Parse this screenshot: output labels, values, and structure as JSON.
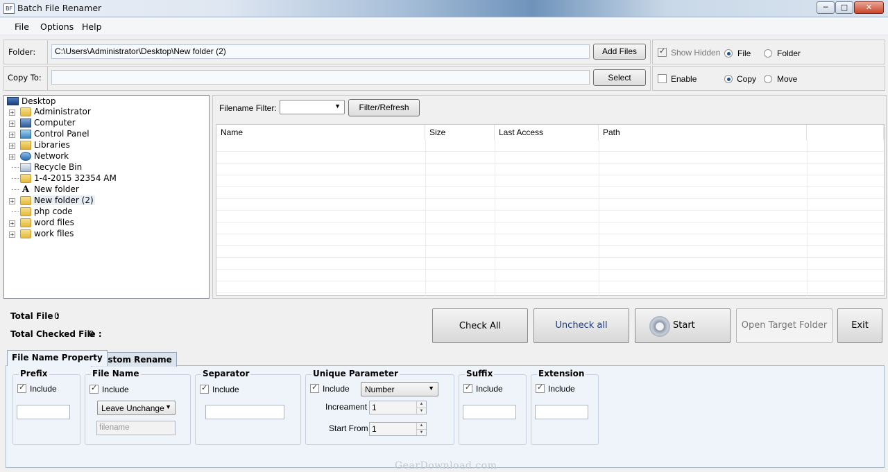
{
  "window": {
    "title": "Batch File Renamer",
    "min": "─",
    "max": "□",
    "close": "✕",
    "icon_text": "BF"
  },
  "menu": [
    "File",
    "Options",
    "Help"
  ],
  "folder": {
    "label": "Folder:",
    "value": "C:\\Users\\Administrator\\Desktop\\New folder (2)",
    "add_files": "Add Files"
  },
  "copy_to": {
    "label": "Copy To:",
    "value": "",
    "select": "Select"
  },
  "options_top": {
    "show_hidden": "Show Hidden",
    "show_hidden_checked": true,
    "file": "File",
    "folder": "Folder",
    "selected": "file"
  },
  "options_bottom": {
    "enable": "Enable",
    "enable_checked": false,
    "copy": "Copy",
    "move": "Move",
    "selected": "copy"
  },
  "tree": {
    "root": "Desktop",
    "items": [
      {
        "label": "Administrator",
        "expandable": true,
        "icon": "user-folder-icon"
      },
      {
        "label": "Computer",
        "expandable": true,
        "icon": "computer-icon"
      },
      {
        "label": "Control Panel",
        "expandable": true,
        "icon": "control-panel-icon"
      },
      {
        "label": "Libraries",
        "expandable": true,
        "icon": "libraries-icon"
      },
      {
        "label": "Network",
        "expandable": true,
        "icon": "network-icon"
      },
      {
        "label": "Recycle Bin",
        "expandable": false,
        "icon": "recycle-bin-icon"
      },
      {
        "label": "1-4-2015 32354 AM",
        "expandable": false,
        "icon": "folder-icon"
      },
      {
        "label": "New folder",
        "expandable": false,
        "icon": "font-icon"
      },
      {
        "label": "New folder (2)",
        "expandable": true,
        "icon": "folder-icon",
        "selected": true
      },
      {
        "label": "php code",
        "expandable": false,
        "icon": "folder-icon"
      },
      {
        "label": "word files",
        "expandable": true,
        "icon": "folder-icon"
      },
      {
        "label": "work files",
        "expandable": true,
        "icon": "folder-icon"
      }
    ]
  },
  "filter": {
    "label": "Filename Filter:",
    "value": "",
    "button": "Filter/Refresh"
  },
  "list": {
    "columns": [
      "Name",
      "Size",
      "Last Access",
      "Path"
    ],
    "rows": []
  },
  "totals": {
    "total_file_label": "Total File :",
    "total_file": "0",
    "total_checked_label": "Total Checked File :",
    "total_checked": "0"
  },
  "actions": {
    "check_all": "Check All",
    "uncheck_all": "Uncheck all",
    "start": "Start",
    "open_target": "Open Target Folder",
    "exit": "Exit"
  },
  "tabs": [
    {
      "label": "File Name Property",
      "active": true
    },
    {
      "label": "Custom Rename",
      "active": false
    }
  ],
  "groups": {
    "prefix": {
      "title": "Prefix",
      "include": "Include",
      "checked": true,
      "value": ""
    },
    "filename": {
      "title": "File Name",
      "include": "Include",
      "checked": true,
      "mode": "Leave Unchange",
      "placeholder": "filename"
    },
    "separator": {
      "title": "Separator",
      "include": "Include",
      "checked": true,
      "value": ""
    },
    "unique": {
      "title": "Unique Parameter",
      "include": "Include",
      "checked": true,
      "type": "Number",
      "increment_label": "Increament",
      "increment": "1",
      "start_label": "Start From",
      "start": "1"
    },
    "suffix": {
      "title": "Suffix",
      "include": "Include",
      "checked": true,
      "value": ""
    },
    "extension": {
      "title": "Extension",
      "include": "Include",
      "checked": true,
      "value": ""
    }
  },
  "watermark": "GearDownload.com"
}
